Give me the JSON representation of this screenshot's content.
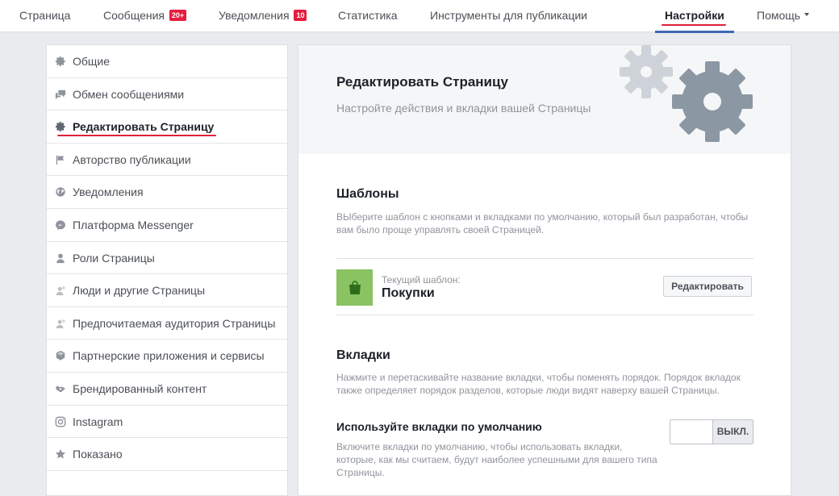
{
  "topnav": {
    "items": [
      {
        "label": "Страница"
      },
      {
        "label": "Сообщения",
        "badge": "20+"
      },
      {
        "label": "Уведомления",
        "badge": "10"
      },
      {
        "label": "Статистика"
      },
      {
        "label": "Инструменты для публикации"
      },
      {
        "label": "Настройки",
        "active": true
      },
      {
        "label": "Помощь"
      }
    ]
  },
  "sidebar": {
    "items": [
      {
        "label": "Общие",
        "icon": "gear-icon"
      },
      {
        "label": "Обмен сообщениями",
        "icon": "messages-icon"
      },
      {
        "label": "Редактировать Страницу",
        "icon": "gear-icon",
        "active": true
      },
      {
        "label": "Авторство публикации",
        "icon": "flag-icon"
      },
      {
        "label": "Уведомления",
        "icon": "globe-icon"
      },
      {
        "label": "Платформа Messenger",
        "icon": "messenger-icon"
      },
      {
        "label": "Роли Страницы",
        "icon": "person-icon"
      },
      {
        "label": "Люди и другие Страницы",
        "icon": "people-icon"
      },
      {
        "label": "Предпочитаемая аудитория Страницы",
        "icon": "audience-icon"
      },
      {
        "label": "Партнерские приложения и сервисы",
        "icon": "cube-icon"
      },
      {
        "label": "Брендированный контент",
        "icon": "handshake-icon"
      },
      {
        "label": "Instagram",
        "icon": "instagram-icon"
      },
      {
        "label": "Показано",
        "icon": "star-icon"
      }
    ]
  },
  "main": {
    "hero": {
      "title": "Редактировать Страницу",
      "subtitle": "Настройте действия и вкладки вашей Страницы"
    },
    "templates": {
      "title": "Шаблоны",
      "description": "ВЫберите шаблон с кнопками и вкладками по умолчанию, который был разработан, чтобы вам было проще управлять своей Страницей.",
      "current_label": "Текущий шаблон:",
      "current_name": "Покупки",
      "edit_button": "Редактировать"
    },
    "tabs": {
      "title": "Вкладки",
      "description": "Нажмите и перетаскивайте название вкладки, чтобы поменять порядок. Порядок вкладок также определяет порядок разделов, которые люди видят наверху вашей Страницы.",
      "default_tabs_title": "Используйте вкладки по умолчанию",
      "default_tabs_desc": "Включите вкладки по умолчанию, чтобы использовать вкладки, которые, как мы считаем, будут наиболее успешными для вашего типа Страницы.",
      "toggle_label": "ВЫКЛ."
    }
  },
  "colors": {
    "accent_blue": "#4267b2",
    "annotation_red": "#e0203a",
    "badge_red": "#e41e3f",
    "template_green": "#8ac361",
    "gear_dark": "#8b98a3",
    "gear_light": "#cdd3d8"
  }
}
